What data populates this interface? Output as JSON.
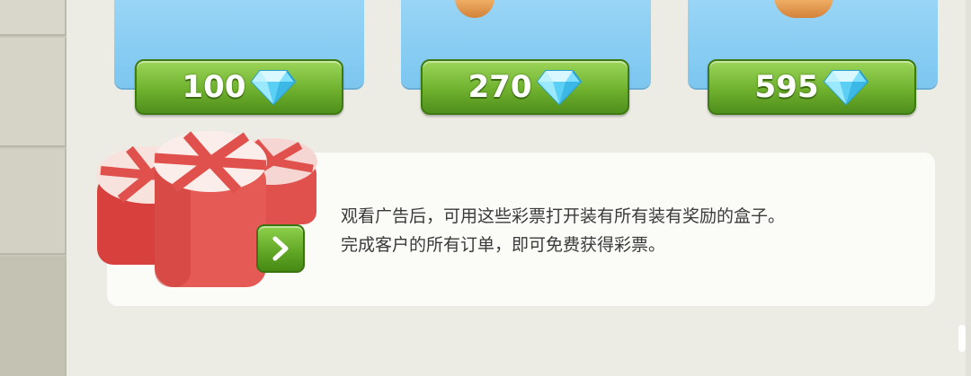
{
  "offers": [
    {
      "price": "100",
      "currency_icon": "diamond-icon"
    },
    {
      "price": "270",
      "currency_icon": "diamond-icon"
    },
    {
      "price": "595",
      "currency_icon": "diamond-icon"
    }
  ],
  "info_panel": {
    "line1": "观看广告后，可用这些彩票打开装有所有装有奖励的盒子。",
    "line2": "完成客户的所有订单，即可免费获得彩票。",
    "arrow_icon": "chevron-right-icon",
    "image_icon": "candy-ticket-icon"
  },
  "colors": {
    "card_blue": "#8fd0f4",
    "button_green": "#6fb12e",
    "panel_bg": "#fbfbf8",
    "text": "#3a3a3a"
  }
}
